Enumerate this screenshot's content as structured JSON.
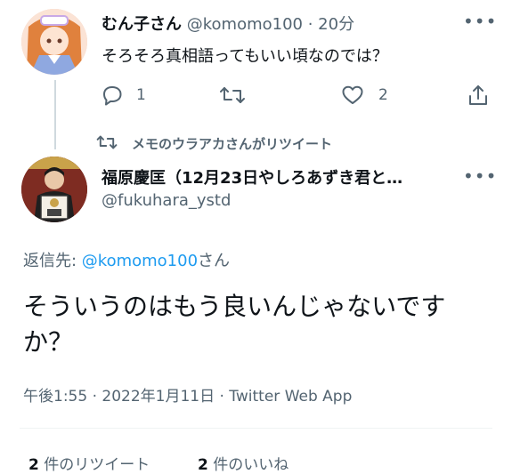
{
  "reply_tweet": {
    "display_name": "むん子さん",
    "handle": "@komomo100",
    "time": "· 20分",
    "text": "そろそろ真相語ってもいい頃なのでは？",
    "reply_count": "1",
    "like_count": "2"
  },
  "retweet_banner": {
    "text": "メモのウラアカさんがリツイート"
  },
  "main_tweet": {
    "display_name": "福原慶匡（12月23日やしろあずき君と…",
    "handle": "@fukuhara_ystd",
    "reply_to_prefix": "返信先: ",
    "reply_to_handle": "@komomo100",
    "reply_to_suffix": "さん",
    "text": "そういうのはもう良いんじゃないですか？",
    "timestamp": "午後1:55 · 2022年1月11日 · Twitter Web App"
  },
  "stats": {
    "retweets_count": "2",
    "retweets_label": " 件のリツイート",
    "likes_count": "2",
    "likes_label": " 件のいいね"
  },
  "colors": {
    "accent": "#1d9bf0",
    "text": "#0f1419",
    "muted": "#536471"
  }
}
